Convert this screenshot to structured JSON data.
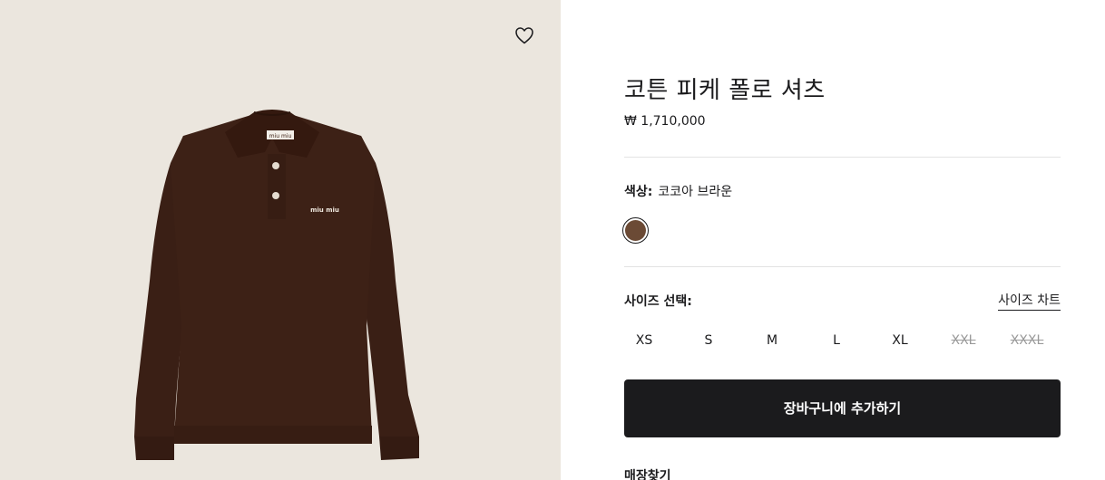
{
  "product": {
    "title": "코튼 피케 폴로 셔츠",
    "price": "₩ 1,710,000",
    "image_logo_text": "miu miu"
  },
  "color": {
    "label": "색상:",
    "value": "코코아 브라운",
    "swatch_hex": "#6b4a35"
  },
  "size": {
    "label": "사이즈 선택:",
    "chart_link": "사이즈 차트",
    "options": [
      "XS",
      "S",
      "M",
      "L",
      "XL",
      "XXL",
      "XXXL"
    ]
  },
  "actions": {
    "add_to_cart": "장바구니에 추가하기",
    "find_store": "매장찾기"
  },
  "icons": {
    "wishlist": "heart-icon"
  },
  "colors": {
    "gallery_bg": "#ebe6de",
    "shirt": "#3d2116",
    "button": "#1b1b1d",
    "disabled": "#9a9a9a"
  }
}
